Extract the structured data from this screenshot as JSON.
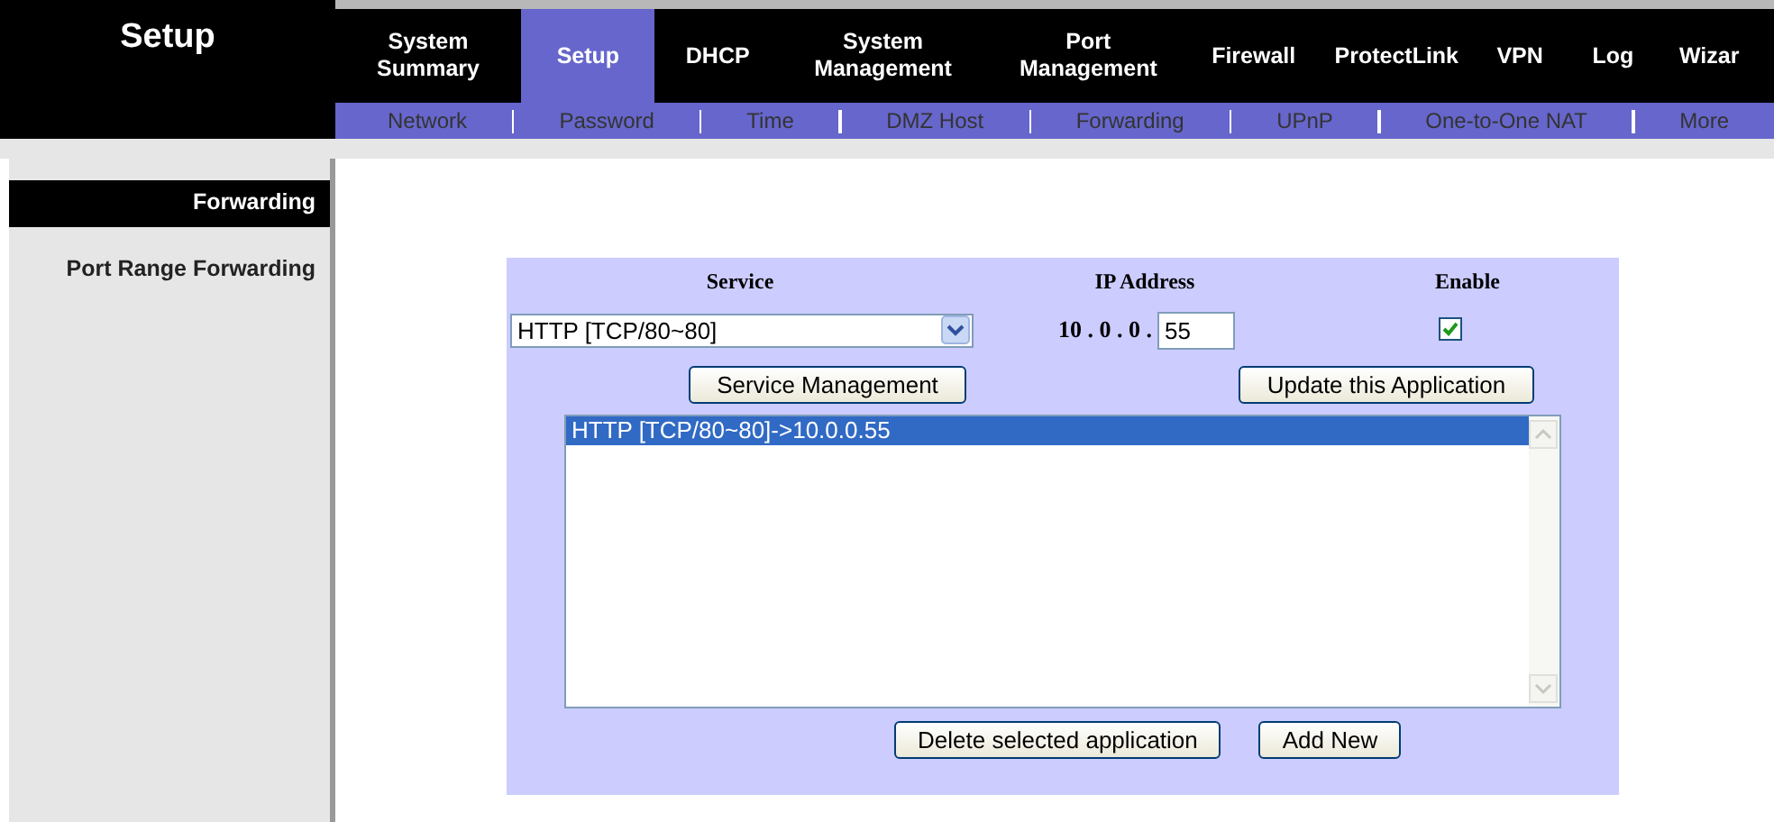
{
  "section_title": "Setup",
  "tabs": [
    {
      "label": "System Summary",
      "selected": false
    },
    {
      "label": "Setup",
      "selected": true
    },
    {
      "label": "DHCP",
      "selected": false
    },
    {
      "label": "System Management",
      "selected": false
    },
    {
      "label": "Port Management",
      "selected": false
    },
    {
      "label": "Firewall",
      "selected": false
    },
    {
      "label": "ProtectLink",
      "selected": false
    },
    {
      "label": "VPN",
      "selected": false
    },
    {
      "label": "Log",
      "selected": false
    },
    {
      "label": "Wizar",
      "selected": false
    }
  ],
  "subtabs": [
    "Network",
    "Password",
    "Time",
    "DMZ Host",
    "Forwarding",
    "UPnP",
    "One-to-One NAT",
    "More"
  ],
  "sidebar": {
    "items": [
      {
        "label": "Forwarding",
        "selected": true
      },
      {
        "label": "Port Range Forwarding",
        "selected": false
      }
    ]
  },
  "form": {
    "headers": [
      "Service",
      "IP Address",
      "Enable"
    ],
    "service": "HTTP [TCP/80~80]",
    "ip_prefix": "10 . 0 . 0 .",
    "ip_last": "55",
    "enabled": true,
    "service_button": "Service Management",
    "update_button": "Update this Application",
    "list": [
      {
        "label": "HTTP [TCP/80~80]->10.0.0.55",
        "selected": true
      }
    ],
    "delete_button": "Delete selected application",
    "add_button": "Add New"
  }
}
